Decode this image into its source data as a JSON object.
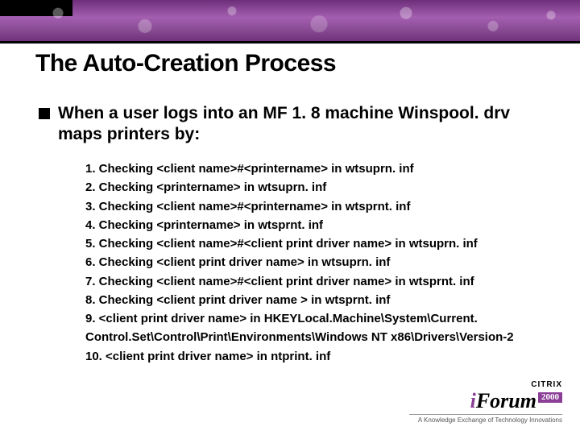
{
  "title": "The Auto-Creation Process",
  "lead": "When a user logs into an MF 1. 8 machine Winspool. drv maps printers by:",
  "steps": [
    "1. Checking <client name>#<printername> in wtsuprn. inf",
    "2. Checking <printername> in wtsuprn. inf",
    "3. Checking <client name>#<printername> in wtsprnt. inf",
    "4. Checking <printername> in wtsprnt. inf",
    "5. Checking <client name>#<client print driver name> in wtsuprn. inf",
    "6. Checking <client print driver name> in wtsuprn. inf",
    "7. Checking <client name>#<client print driver name> in wtsprnt. inf",
    "8. Checking <client print driver name > in wtsprnt. inf",
    "9. <client print driver name> in HKEYLocal.Machine\\System\\Current. Control.Set\\Control\\Print\\Environments\\Windows NT x86\\Drivers\\Version-2",
    "10. <client print driver name> in ntprint. inf"
  ],
  "logo": {
    "brand_top": "CITRIX",
    "i": "i",
    "forum": "Forum",
    "year": "2000",
    "tagline": "A Knowledge Exchange of Technology Innovations"
  }
}
